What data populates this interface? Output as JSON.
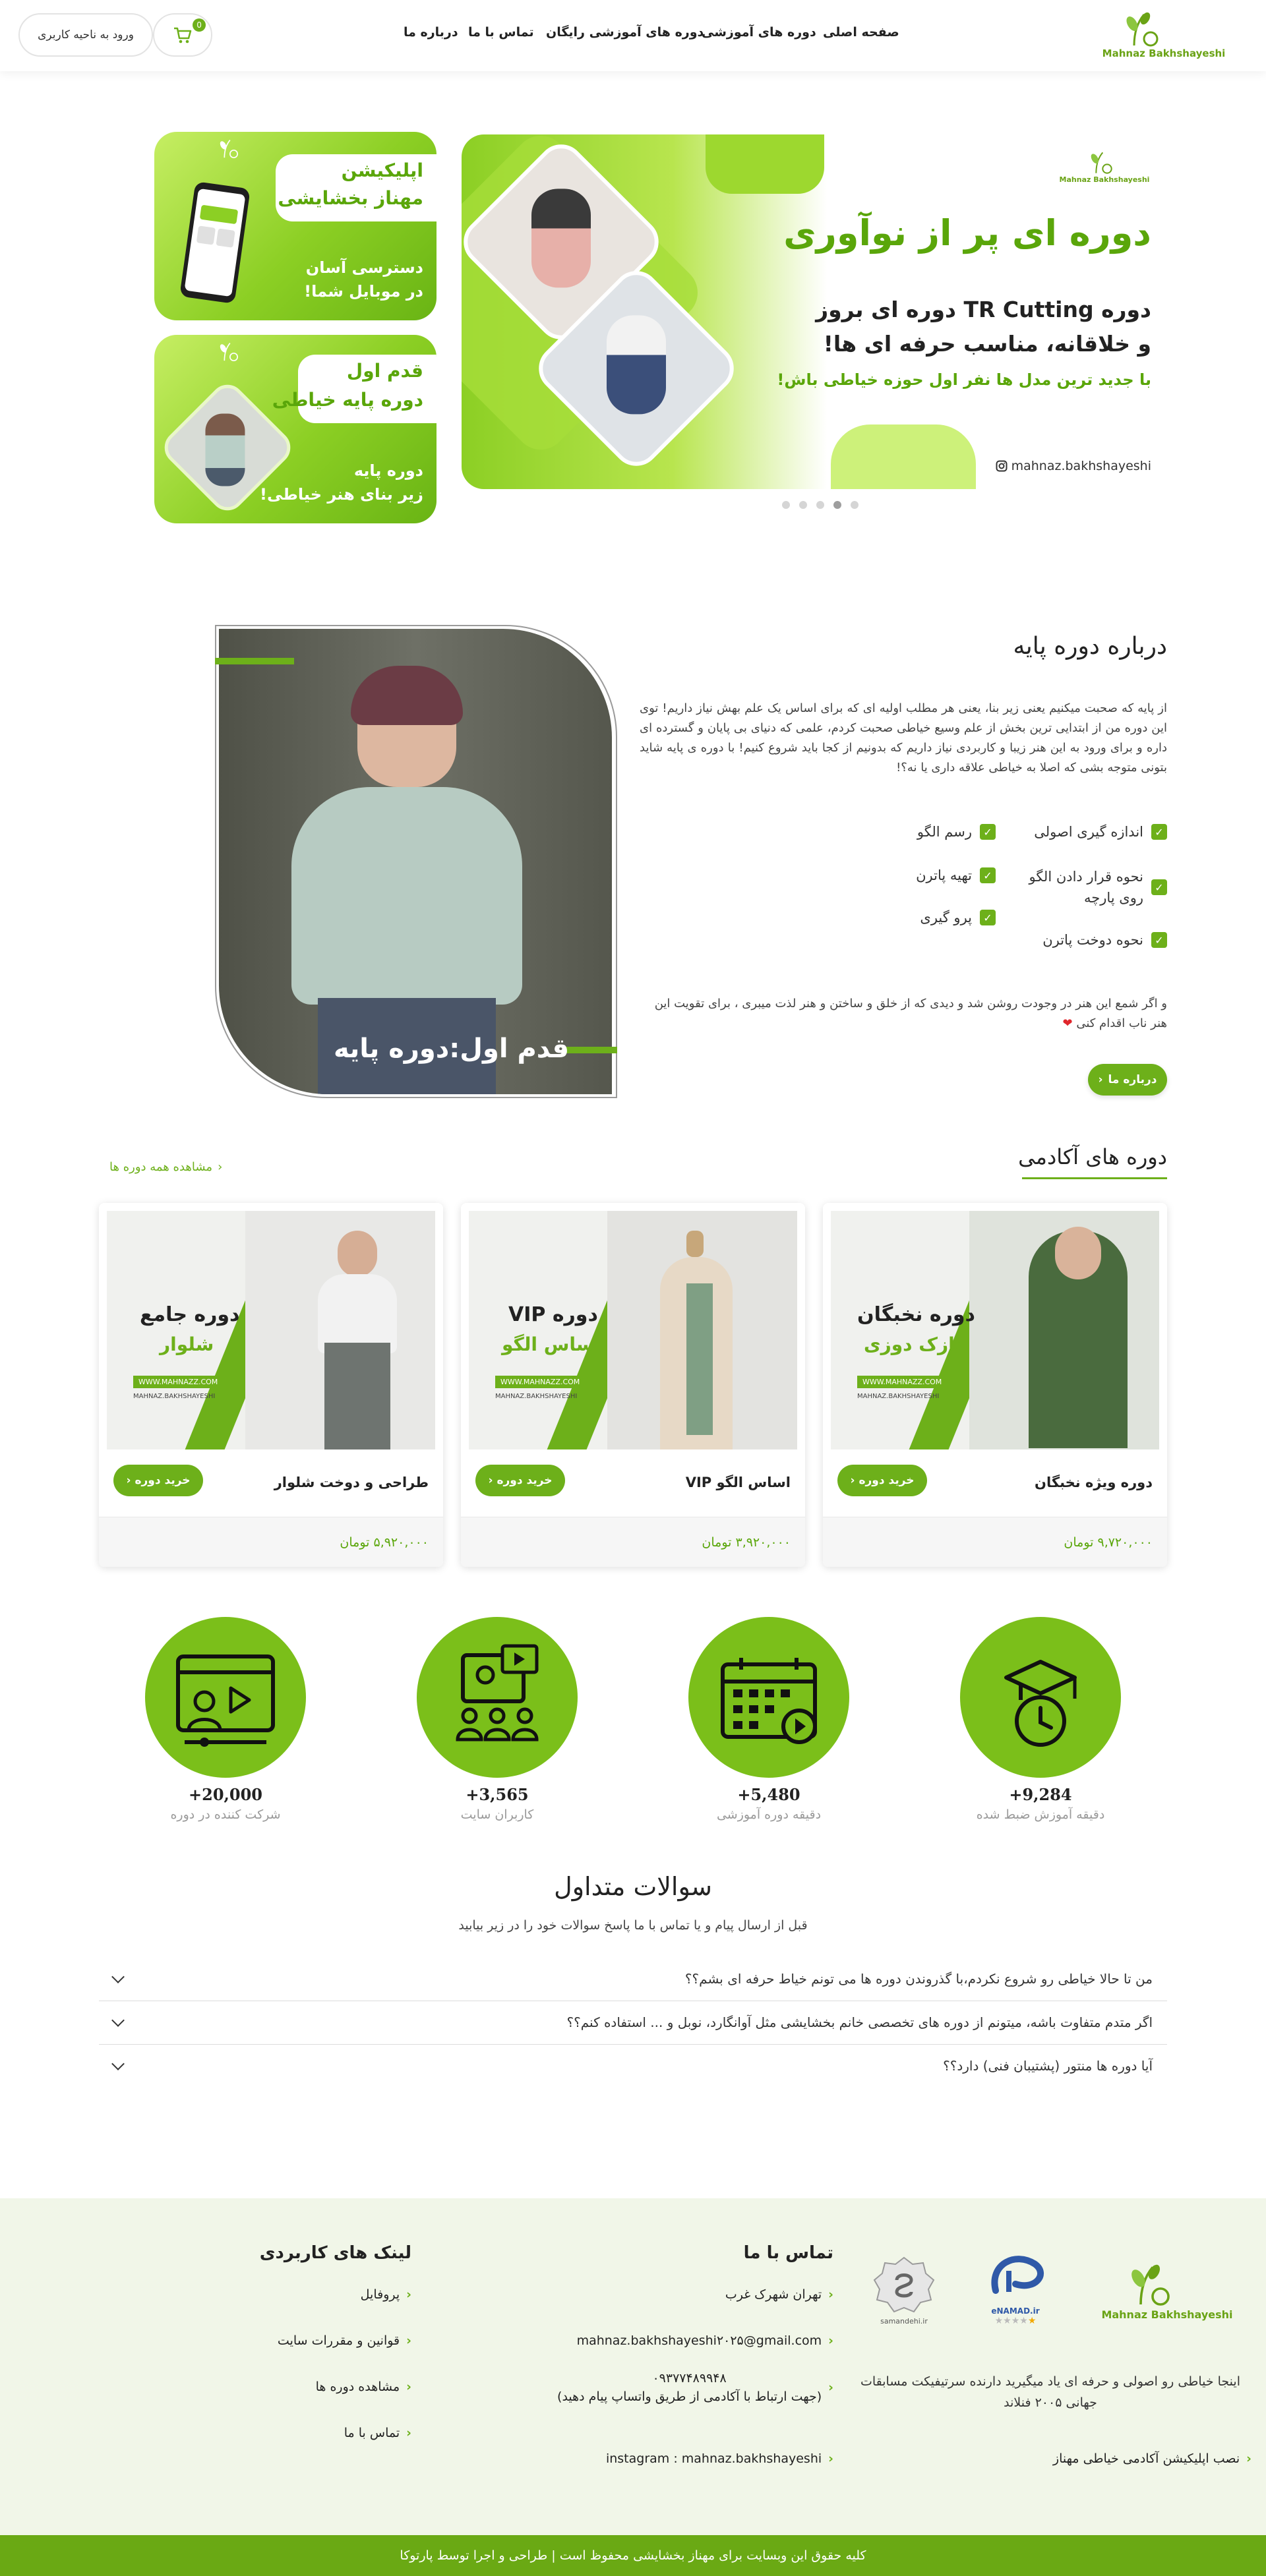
{
  "header": {
    "logo_text": "Mahnaz Bakhshayeshi",
    "nav": [
      "صفحه اصلی",
      "دوره های آموزشی",
      "دوره های آموزشی رایگان",
      "تماس با ما",
      "درباره ما"
    ],
    "login_label": "ورود به ناحیه کاربری",
    "cart_count": "0"
  },
  "hero": {
    "slide": {
      "logo_text": "Mahnaz Bakhshayeshi",
      "title": "دوره ای پر از نوآوری",
      "line1": "دوره TR Cutting دوره ای بروز",
      "line2": "و خلاقانه، مناسب حرفه ای ها!",
      "line3": "با جدید ترین مدل ها نفر اول حوزه خیاطی باش!",
      "instagram": "mahnaz.bakhshayeshi"
    },
    "dots": 5,
    "active_dot": 4,
    "app_card": {
      "title1": "اپلیکیشن",
      "title2": "مهناز بخشایشی",
      "sub1": "دسترسی آسان",
      "sub2": "در موبایل شما!"
    },
    "basic_card": {
      "title1": "قدم اول",
      "title2": "دوره پایه خیاطی",
      "sub1": "دوره پایه",
      "sub2": "زیر بنای هنر خیاطی!"
    }
  },
  "about": {
    "heading": "درباره دوره پایه",
    "paragraph": "از پایه که صحبت میکنیم یعنی زیر بنا، یعنی هر مطلب اولیه ای که برای اساس یک علم بهش نیاز داریم! توی این دوره من از ابتدایی ترین بخش از علم وسیع خیاطی صحبت کردم، علمی که دنیای بی پایان و گسترده ای داره و برای ورود به این هنر زیبا و کاربردی نیاز داریم که بدونیم از کجا باید شروع کنیم! با دوره ی پایه شاید بتونی متوجه بشی که اصلا به خیاطی علاقه داری یا نه؟!",
    "checklist": [
      "اندازه گیری اصولی",
      "رسم الگو",
      "نحوه قرار دادن الگو روی پارچه",
      "تهیه پاترن",
      "نحوه دوخت پاترن",
      "پرو گیری"
    ],
    "closing": "و اگر شمع این هنر در وجودت روشن شد و دیدی که از خلق و ساختن و هنر لذت میبری ، برای تقویت این هنر ناب اقدام کنی",
    "button": "درباره ما",
    "image_caption": "قدم اول:دوره پایه"
  },
  "courses": {
    "heading": "دوره های آکادمی",
    "view_all": "مشاهده همه دوره ها",
    "buy_label": "خرید دوره",
    "items": [
      {
        "title": "دوره ویژه نخبگان",
        "price": "۹,۷۲۰,۰۰۰ تومان",
        "img_line1": "دوره نخبگان",
        "img_line2": "نازک دوزی",
        "img_site": "WWW.MAHNAZZ.COM",
        "img_insta": "MAHNAZ.BAKHSHAYESHI"
      },
      {
        "title": "اساس الگو VIP",
        "price": "۳,۹۲۰,۰۰۰ تومان",
        "img_line1": "دوره VIP",
        "img_line2": "اساس الگو",
        "img_site": "WWW.MAHNAZZ.COM",
        "img_insta": "MAHNAZ.BAKHSHAYESHI"
      },
      {
        "title": "طراحی و دوخت شلوار",
        "price": "۵,۹۲۰,۰۰۰ تومان",
        "img_line1": "دوره جامع",
        "img_line2": "شلوار",
        "img_site": "WWW.MAHNAZZ.COM",
        "img_insta": "MAHNAZ.BAKHSHAYESHI"
      }
    ]
  },
  "stats": [
    {
      "number": "9,284+",
      "label": "دقیقه آموزش ضبط شده",
      "icon": "graduation-clock-icon"
    },
    {
      "number": "5,480+",
      "label": "دقیقه دوره آموزشی",
      "icon": "calendar-video-icon"
    },
    {
      "number": "3,565+",
      "label": "کاربران سایت",
      "icon": "online-class-icon"
    },
    {
      "number": "20,000+",
      "label": "شرکت کننده در دوره",
      "icon": "video-player-icon"
    }
  ],
  "faq": {
    "heading": "سوالات متداول",
    "subheading": "قبل از ارسال پیام و یا تماس با ما پاسخ سوالات خود را در زیر بیابید",
    "items": [
      "من تا حالا خیاطی رو شروع نکردم،با گذروندن دوره ها می تونم خیاط حرفه ای بشم؟؟",
      "اگر متدم متفاوت باشه، میتونم از دوره های تخصصی خانم بخشایشی مثل آوانگارد، نوبل و ... استفاده کنم؟؟",
      "آیا دوره ها منتور (پشتیبان فنی) دارد؟؟"
    ]
  },
  "footer": {
    "about_text": "اینجا خیاطی رو اصولی و حرفه ای یاد میگیرید دارنده سرتیفیکت مسابقات جهانی ۲۰۰۵ فنلاند",
    "app_link": "نصب اپلیکیشن آکادمی خیاطی مهناز",
    "enamad_label": "eNAMAD.ir",
    "samandehi_label": "samandehi.ir",
    "contact_heading": "تماس با ما",
    "contact": [
      "تهران شهرک غرب",
      "mahnaz.bakhshayeshi۲۰۲۵@gmail.com",
      "۰۹۳۷۷۴۸۹۹۴۸",
      "(جهت ارتباط با آکادمی از طریق واتساپ پیام دهید)",
      "instagram : mahnaz.bakhshayeshi"
    ],
    "links_heading": "لینک های کاربردی",
    "links": [
      "پروفایل",
      "قوانین و مقررات سایت",
      "مشاهده دوره ها",
      "تماس با ما"
    ],
    "copyright": "کلیه حقوق این وبسایت برای مهناز بخشایشی محفوظ است | طراحی و اجرا توسط پارتوکا"
  },
  "colors": {
    "accent": "#6db01a",
    "accent_light": "#c6ee63",
    "footer_bg": "#f1f6e8",
    "copyright_bg": "#6aa914"
  }
}
